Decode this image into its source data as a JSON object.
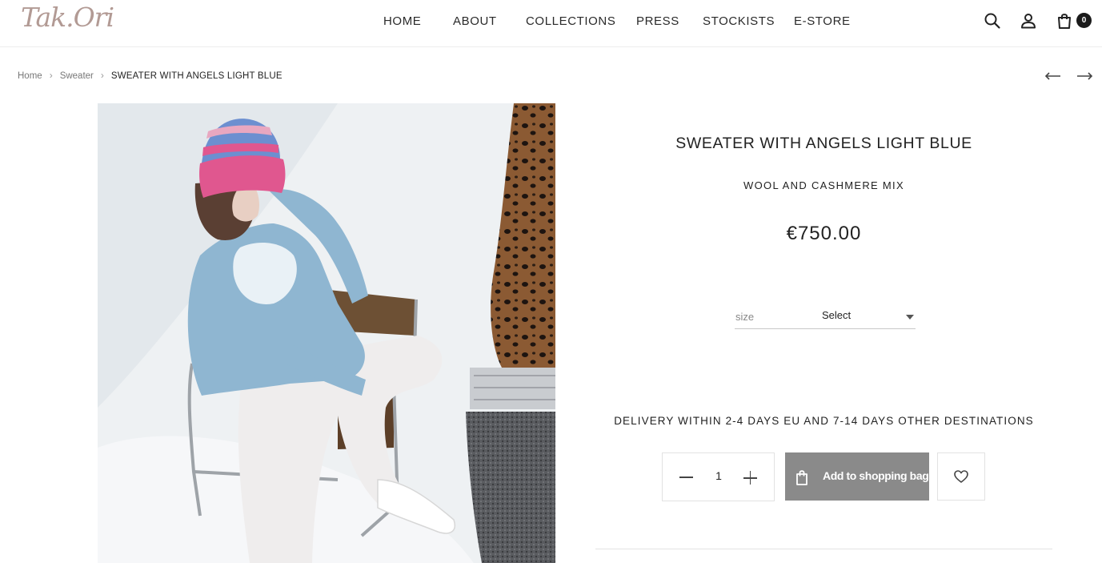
{
  "brand": {
    "logo_text": "Tak.Ori"
  },
  "nav": {
    "items": [
      {
        "label": "HOME"
      },
      {
        "label": "ABOUT"
      },
      {
        "label": "COLLECTIONS"
      },
      {
        "label": "PRESS"
      },
      {
        "label": "STOCKISTS"
      },
      {
        "label": "E-STORE"
      }
    ]
  },
  "header_icons": {
    "search": "search-icon",
    "account": "user-icon",
    "cart": "shopping-bag-icon",
    "cart_count": "0"
  },
  "breadcrumb": {
    "home": "Home",
    "category": "Sweater",
    "current": "SWEATER WITH ANGELS LIGHT BLUE"
  },
  "pager": {
    "prev": "arrow-left-icon",
    "next": "arrow-right-icon"
  },
  "product": {
    "title": "SWEATER WITH ANGELS LIGHT BLUE",
    "subtitle": "WOOL AND CASHMERE MIX",
    "price": "€750.00",
    "size_label": "size",
    "size_value": "Select",
    "delivery_note": "DELIVERY WITHIN 2-4 DAYS EU AND 7-14 DAYS OTHER DESTINATIONS",
    "quantity": "1",
    "add_to_bag_label": "Add to shopping bag"
  },
  "colors": {
    "logo": "#b29a94",
    "button": "#8a8a8a",
    "sweater": "#8fb6d1",
    "beanie_pink": "#e0578f",
    "beanie_blue": "#6c8fd0"
  }
}
